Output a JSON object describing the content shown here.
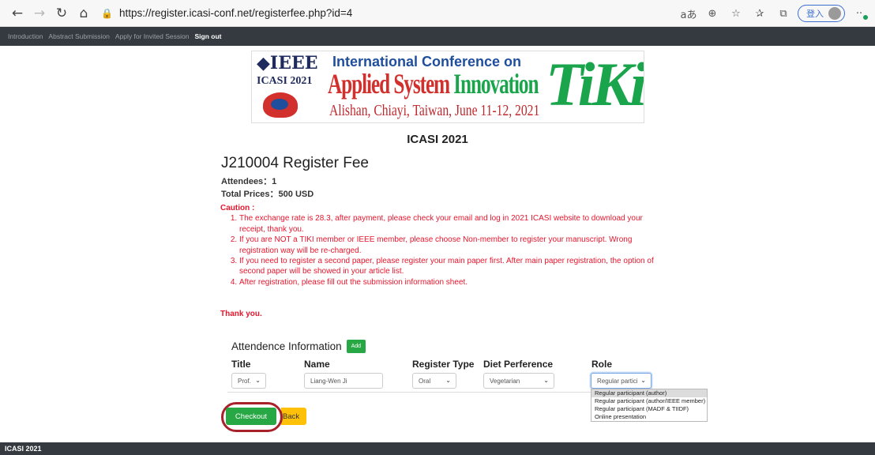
{
  "browser": {
    "url": "https://register.icasi-conf.net/registerfee.php?id=4",
    "profile_label": "登入",
    "icons": [
      "back-icon",
      "forward-icon",
      "refresh-icon",
      "home-icon",
      "lock-icon",
      "read-aloud-icon",
      "zoom-icon",
      "favorite-add-icon",
      "favorites-icon",
      "collections-icon",
      "more-icon"
    ]
  },
  "site_nav": {
    "items": [
      "Introduction",
      "Abstract Submission",
      "Apply for Invited Session",
      "Sign out"
    ]
  },
  "banner": {
    "org": "IEEE",
    "event_short": "ICASI 2021",
    "line1": "International Conference on",
    "line2_a": "Applied",
    "line2_b": "System",
    "line2_c": "Innovation",
    "line3": "Alishan, Chiayi, Taiwan, June 11-12, 2021",
    "partner_logo": "TiKi"
  },
  "page": {
    "conference_title": "ICASI 2021",
    "register_title": "J210004 Register Fee",
    "attendees": "Attendees：1",
    "total_prices": "Total Prices：500 USD"
  },
  "caution": {
    "heading": "Caution :",
    "items": [
      "The exchange rate is 28.3, after payment, please check your email and log in 2021 ICASI website to download your receipt, thank you.",
      "If you are NOT a TIKI member or IEEE member, please choose Non-member to register your manuscript. Wrong registration way will be re-charged.",
      "If you need to register a second paper, please register your main paper first. After main paper registration, the option of second paper will be showed in your article list.",
      "After registration, please fill out the submission information sheet."
    ],
    "thanks": "Thank you."
  },
  "attendance": {
    "heading": "Attendence Information",
    "add_label": "Add",
    "columns": {
      "title": "Title",
      "name": "Name",
      "register_type": "Register Type",
      "diet": "Diet Perference",
      "role": "Role"
    },
    "row": {
      "title": "Prof.",
      "name": "Liang-Wen Ji",
      "register_type": "Oral",
      "diet": "Vegetarian",
      "role": "Regular partici"
    },
    "role_options": [
      "Regular participant (author)",
      "Regular participant (author/IEEE member)",
      "Regular participant (MADF & TIIDF)",
      "Online presentation"
    ],
    "role_selected_index": 0
  },
  "actions": {
    "checkout": "Checkout",
    "back": "Back"
  },
  "footer": {
    "text": "ICASI 2021"
  },
  "colors": {
    "nav_bg": "#343a40",
    "caution_red": "#e8162d",
    "success_green": "#28a745",
    "warning_yellow": "#ffc107",
    "highlight_ring": "#a8202a"
  }
}
